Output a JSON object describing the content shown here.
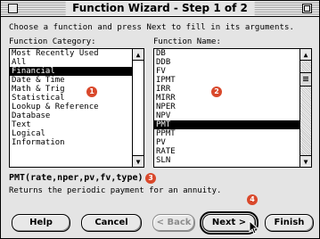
{
  "window": {
    "title": "Function Wizard - Step 1 of 2"
  },
  "instruction": "Choose a function and press Next to fill in its arguments.",
  "category": {
    "label": "Function Category:",
    "items": [
      "Most Recently Used",
      "All",
      "Financial",
      "Date & Time",
      "Math & Trig",
      "Statistical",
      "Lookup & Reference",
      "Database",
      "Text",
      "Logical",
      "Information"
    ],
    "selected": "Financial"
  },
  "function": {
    "label": "Function Name:",
    "items": [
      "DB",
      "DDB",
      "FV",
      "IPMT",
      "IRR",
      "MIRR",
      "NPER",
      "NPV",
      "PMT",
      "PPMT",
      "PV",
      "RATE",
      "SLN"
    ],
    "selected": "PMT"
  },
  "syntax": "PMT(rate,nper,pv,fv,type)",
  "description": "Returns the periodic payment for an annuity.",
  "callouts": [
    "1",
    "2",
    "3",
    "4"
  ],
  "buttons": {
    "help": "Help",
    "cancel": "Cancel",
    "back": "< Back",
    "next": "Next >",
    "finish": "Finish"
  },
  "scroll_glyphs": {
    "up": "▲",
    "down": "▼"
  },
  "colors": {
    "callout": "#d9482b",
    "selection": "#000000"
  }
}
